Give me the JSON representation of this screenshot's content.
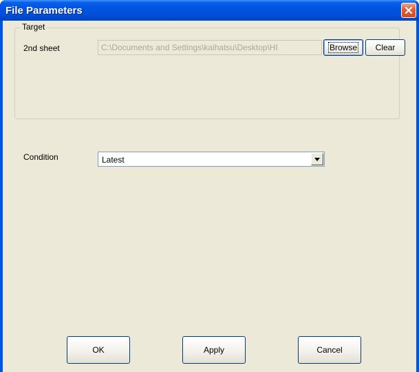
{
  "window": {
    "title": "File Parameters",
    "close_icon": "close-icon"
  },
  "target_group": {
    "label": "Target",
    "second_sheet_label": "2nd sheet",
    "path_value": "C:\\Documents and Settings\\kaihatsu\\Desktop\\HI",
    "browse_label": "Browse",
    "clear_label": "Clear"
  },
  "condition": {
    "label": "Condition",
    "selected": "Latest"
  },
  "buttons": {
    "ok": "OK",
    "apply": "Apply",
    "cancel": "Cancel"
  },
  "colors": {
    "titlebar": "#0054e3",
    "dialog_background": "#ece9d8",
    "close_button": "#e0603a"
  }
}
